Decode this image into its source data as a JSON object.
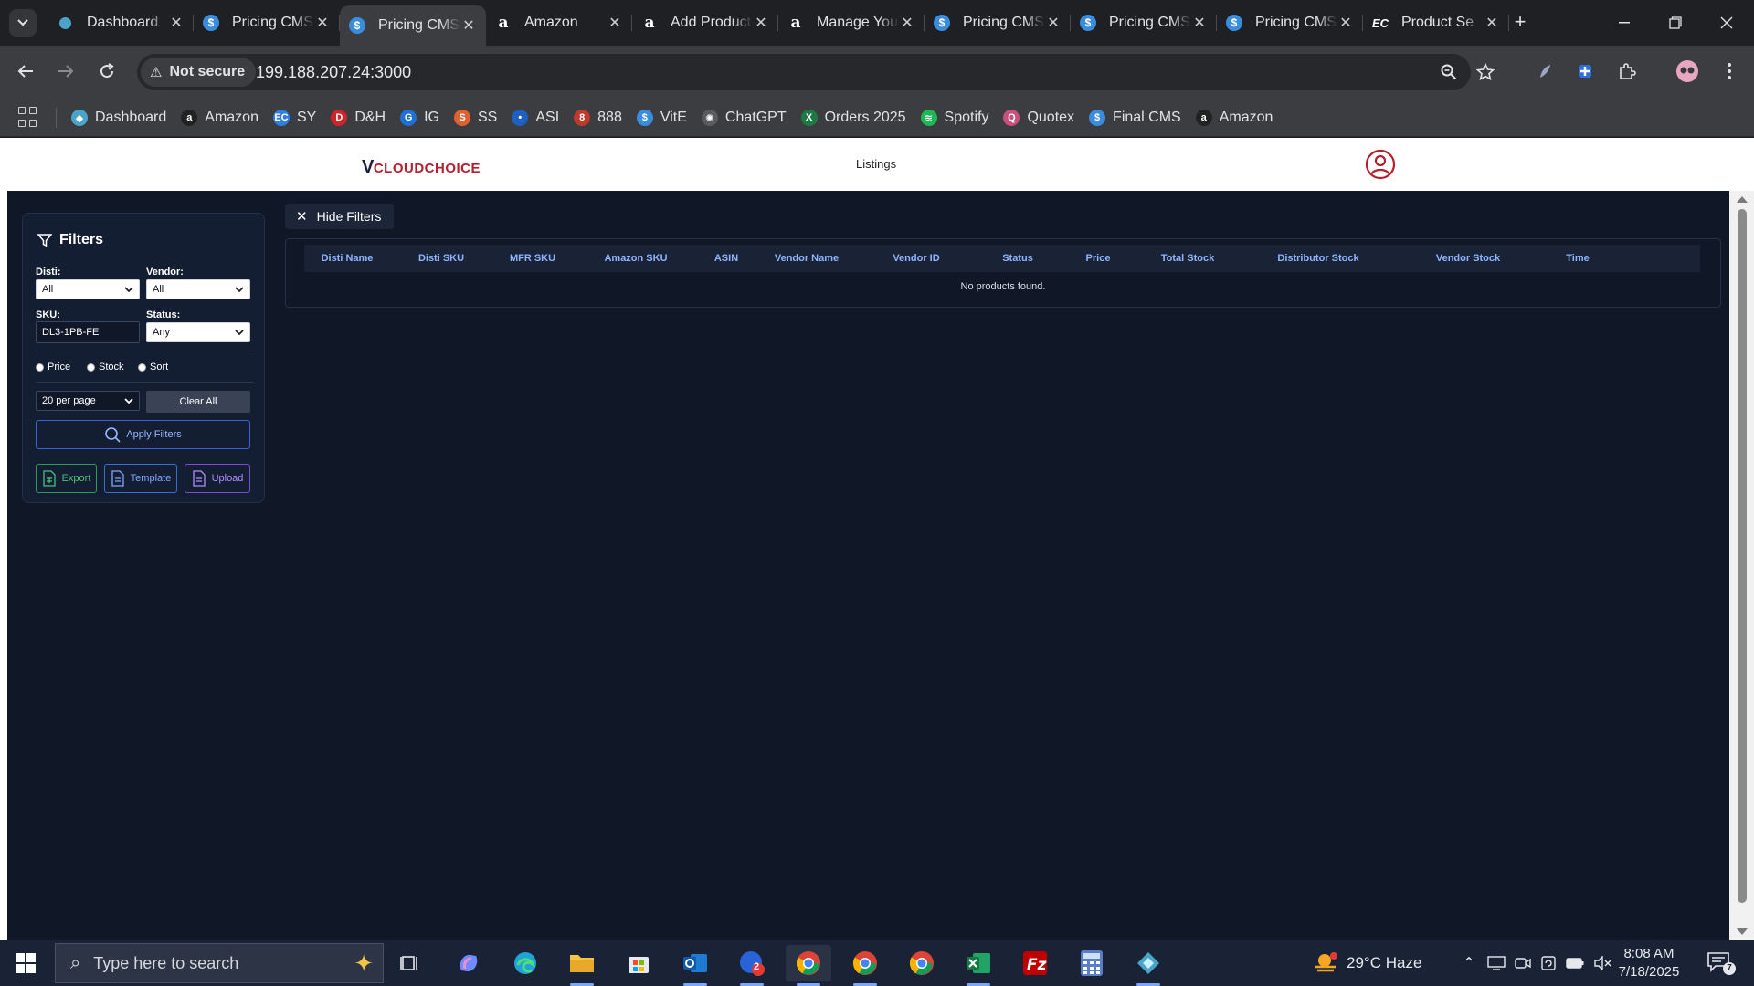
{
  "browser": {
    "tabs": [
      {
        "title": "Dashboard",
        "icon": "dashboard-icon",
        "active": false
      },
      {
        "title": "Pricing CMS",
        "icon": "dollar-icon",
        "active": false
      },
      {
        "title": "Pricing CMS",
        "icon": "dollar-icon",
        "active": true
      },
      {
        "title": "Amazon",
        "icon": "amazon-icon",
        "active": false
      },
      {
        "title": "Add Product",
        "icon": "amazon-icon",
        "active": false
      },
      {
        "title": "Manage Your",
        "icon": "amazon-icon",
        "active": false
      },
      {
        "title": "Pricing CMS",
        "icon": "dollar-icon",
        "active": false
      },
      {
        "title": "Pricing CMS",
        "icon": "dollar-icon",
        "active": false
      },
      {
        "title": "Pricing CMS",
        "icon": "dollar-icon",
        "active": false
      },
      {
        "title": "Product Se",
        "icon": "ec-icon",
        "active": false
      }
    ],
    "security_label": "Not secure",
    "url": "199.188.207.24:3000",
    "bookmarks": [
      {
        "label": "Dashboard",
        "icon": "dashboard-icon",
        "color": "#4aa3c8"
      },
      {
        "label": "Amazon",
        "icon": "amazon-icon",
        "color": "#222222"
      },
      {
        "label": "SY",
        "icon": "ec-icon",
        "color": "#2f7de1"
      },
      {
        "label": "D&H",
        "icon": "dh-icon",
        "color": "#d2232a"
      },
      {
        "label": "IG",
        "icon": "ig-icon",
        "color": "#1e6fd6"
      },
      {
        "label": "SS",
        "icon": "ss-icon",
        "color": "#e06030"
      },
      {
        "label": "ASI",
        "icon": "asi-icon",
        "color": "#1f5fbf"
      },
      {
        "label": "888",
        "icon": "888-icon",
        "color": "#c0392b"
      },
      {
        "label": "VitE",
        "icon": "dollar-icon",
        "color": "#3a8dde"
      },
      {
        "label": "ChatGPT",
        "icon": "chatgpt-icon",
        "color": "#5a5b5f"
      },
      {
        "label": "Orders 2025",
        "icon": "excel-icon",
        "color": "#1d7a45"
      },
      {
        "label": "Spotify",
        "icon": "spotify-icon",
        "color": "#1db954"
      },
      {
        "label": "Quotex",
        "icon": "quotex-icon",
        "color": "#c94f7c"
      },
      {
        "label": "Final CMS",
        "icon": "dollar-icon",
        "color": "#3a8dde"
      },
      {
        "label": "Amazon",
        "icon": "amazon-icon",
        "color": "#222222"
      }
    ]
  },
  "app": {
    "logo_v": "V",
    "logo_cloud": "CLOUD",
    "logo_choice": "CHOICE",
    "nav_listings": "Listings",
    "hide_filters": "Hide Filters",
    "filters": {
      "title": "Filters",
      "disti_label": "Disti:",
      "disti_value": "All",
      "vendor_label": "Vendor:",
      "vendor_value": "All",
      "sku_label": "SKU:",
      "sku_value": "DL3-1PB-FE",
      "status_label": "Status:",
      "status_value": "Any",
      "sort_options": [
        "Price",
        "Stock",
        "Sort"
      ],
      "per_page": "20 per page",
      "clear_all": "Clear All",
      "apply": "Apply Filters",
      "export": "Export",
      "template": "Template",
      "upload": "Upload"
    },
    "table": {
      "columns": [
        "Disti Name",
        "Disti SKU",
        "MFR SKU",
        "Amazon SKU",
        "ASIN",
        "Vendor Name",
        "Vendor ID",
        "Status",
        "Price",
        "Total Stock",
        "Distributor Stock",
        "Vendor Stock",
        "Time"
      ],
      "empty_message": "No products found."
    }
  },
  "taskbar": {
    "search_placeholder": "Type here to search",
    "weather": "29°C  Haze",
    "time": "8:08 AM",
    "date": "7/18/2025",
    "notification_count": "7",
    "mail_badge": "2"
  }
}
